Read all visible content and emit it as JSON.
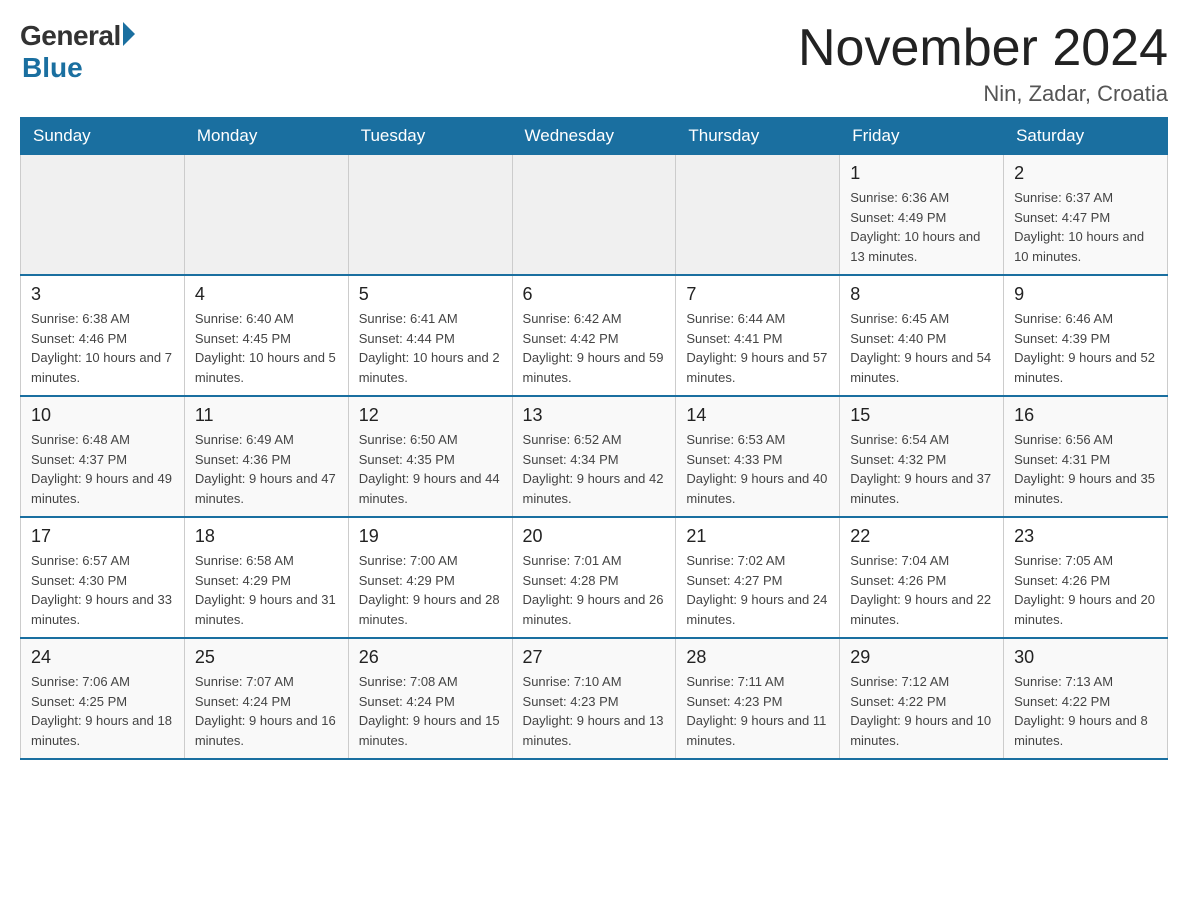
{
  "header": {
    "logo_general": "General",
    "logo_blue": "Blue",
    "month_title": "November 2024",
    "location": "Nin, Zadar, Croatia"
  },
  "days_of_week": [
    "Sunday",
    "Monday",
    "Tuesday",
    "Wednesday",
    "Thursday",
    "Friday",
    "Saturday"
  ],
  "weeks": [
    [
      {
        "day": "",
        "sunrise": "",
        "sunset": "",
        "daylight": ""
      },
      {
        "day": "",
        "sunrise": "",
        "sunset": "",
        "daylight": ""
      },
      {
        "day": "",
        "sunrise": "",
        "sunset": "",
        "daylight": ""
      },
      {
        "day": "",
        "sunrise": "",
        "sunset": "",
        "daylight": ""
      },
      {
        "day": "",
        "sunrise": "",
        "sunset": "",
        "daylight": ""
      },
      {
        "day": "1",
        "sunrise": "Sunrise: 6:36 AM",
        "sunset": "Sunset: 4:49 PM",
        "daylight": "Daylight: 10 hours and 13 minutes."
      },
      {
        "day": "2",
        "sunrise": "Sunrise: 6:37 AM",
        "sunset": "Sunset: 4:47 PM",
        "daylight": "Daylight: 10 hours and 10 minutes."
      }
    ],
    [
      {
        "day": "3",
        "sunrise": "Sunrise: 6:38 AM",
        "sunset": "Sunset: 4:46 PM",
        "daylight": "Daylight: 10 hours and 7 minutes."
      },
      {
        "day": "4",
        "sunrise": "Sunrise: 6:40 AM",
        "sunset": "Sunset: 4:45 PM",
        "daylight": "Daylight: 10 hours and 5 minutes."
      },
      {
        "day": "5",
        "sunrise": "Sunrise: 6:41 AM",
        "sunset": "Sunset: 4:44 PM",
        "daylight": "Daylight: 10 hours and 2 minutes."
      },
      {
        "day": "6",
        "sunrise": "Sunrise: 6:42 AM",
        "sunset": "Sunset: 4:42 PM",
        "daylight": "Daylight: 9 hours and 59 minutes."
      },
      {
        "day": "7",
        "sunrise": "Sunrise: 6:44 AM",
        "sunset": "Sunset: 4:41 PM",
        "daylight": "Daylight: 9 hours and 57 minutes."
      },
      {
        "day": "8",
        "sunrise": "Sunrise: 6:45 AM",
        "sunset": "Sunset: 4:40 PM",
        "daylight": "Daylight: 9 hours and 54 minutes."
      },
      {
        "day": "9",
        "sunrise": "Sunrise: 6:46 AM",
        "sunset": "Sunset: 4:39 PM",
        "daylight": "Daylight: 9 hours and 52 minutes."
      }
    ],
    [
      {
        "day": "10",
        "sunrise": "Sunrise: 6:48 AM",
        "sunset": "Sunset: 4:37 PM",
        "daylight": "Daylight: 9 hours and 49 minutes."
      },
      {
        "day": "11",
        "sunrise": "Sunrise: 6:49 AM",
        "sunset": "Sunset: 4:36 PM",
        "daylight": "Daylight: 9 hours and 47 minutes."
      },
      {
        "day": "12",
        "sunrise": "Sunrise: 6:50 AM",
        "sunset": "Sunset: 4:35 PM",
        "daylight": "Daylight: 9 hours and 44 minutes."
      },
      {
        "day": "13",
        "sunrise": "Sunrise: 6:52 AM",
        "sunset": "Sunset: 4:34 PM",
        "daylight": "Daylight: 9 hours and 42 minutes."
      },
      {
        "day": "14",
        "sunrise": "Sunrise: 6:53 AM",
        "sunset": "Sunset: 4:33 PM",
        "daylight": "Daylight: 9 hours and 40 minutes."
      },
      {
        "day": "15",
        "sunrise": "Sunrise: 6:54 AM",
        "sunset": "Sunset: 4:32 PM",
        "daylight": "Daylight: 9 hours and 37 minutes."
      },
      {
        "day": "16",
        "sunrise": "Sunrise: 6:56 AM",
        "sunset": "Sunset: 4:31 PM",
        "daylight": "Daylight: 9 hours and 35 minutes."
      }
    ],
    [
      {
        "day": "17",
        "sunrise": "Sunrise: 6:57 AM",
        "sunset": "Sunset: 4:30 PM",
        "daylight": "Daylight: 9 hours and 33 minutes."
      },
      {
        "day": "18",
        "sunrise": "Sunrise: 6:58 AM",
        "sunset": "Sunset: 4:29 PM",
        "daylight": "Daylight: 9 hours and 31 minutes."
      },
      {
        "day": "19",
        "sunrise": "Sunrise: 7:00 AM",
        "sunset": "Sunset: 4:29 PM",
        "daylight": "Daylight: 9 hours and 28 minutes."
      },
      {
        "day": "20",
        "sunrise": "Sunrise: 7:01 AM",
        "sunset": "Sunset: 4:28 PM",
        "daylight": "Daylight: 9 hours and 26 minutes."
      },
      {
        "day": "21",
        "sunrise": "Sunrise: 7:02 AM",
        "sunset": "Sunset: 4:27 PM",
        "daylight": "Daylight: 9 hours and 24 minutes."
      },
      {
        "day": "22",
        "sunrise": "Sunrise: 7:04 AM",
        "sunset": "Sunset: 4:26 PM",
        "daylight": "Daylight: 9 hours and 22 minutes."
      },
      {
        "day": "23",
        "sunrise": "Sunrise: 7:05 AM",
        "sunset": "Sunset: 4:26 PM",
        "daylight": "Daylight: 9 hours and 20 minutes."
      }
    ],
    [
      {
        "day": "24",
        "sunrise": "Sunrise: 7:06 AM",
        "sunset": "Sunset: 4:25 PM",
        "daylight": "Daylight: 9 hours and 18 minutes."
      },
      {
        "day": "25",
        "sunrise": "Sunrise: 7:07 AM",
        "sunset": "Sunset: 4:24 PM",
        "daylight": "Daylight: 9 hours and 16 minutes."
      },
      {
        "day": "26",
        "sunrise": "Sunrise: 7:08 AM",
        "sunset": "Sunset: 4:24 PM",
        "daylight": "Daylight: 9 hours and 15 minutes."
      },
      {
        "day": "27",
        "sunrise": "Sunrise: 7:10 AM",
        "sunset": "Sunset: 4:23 PM",
        "daylight": "Daylight: 9 hours and 13 minutes."
      },
      {
        "day": "28",
        "sunrise": "Sunrise: 7:11 AM",
        "sunset": "Sunset: 4:23 PM",
        "daylight": "Daylight: 9 hours and 11 minutes."
      },
      {
        "day": "29",
        "sunrise": "Sunrise: 7:12 AM",
        "sunset": "Sunset: 4:22 PM",
        "daylight": "Daylight: 9 hours and 10 minutes."
      },
      {
        "day": "30",
        "sunrise": "Sunrise: 7:13 AM",
        "sunset": "Sunset: 4:22 PM",
        "daylight": "Daylight: 9 hours and 8 minutes."
      }
    ]
  ]
}
